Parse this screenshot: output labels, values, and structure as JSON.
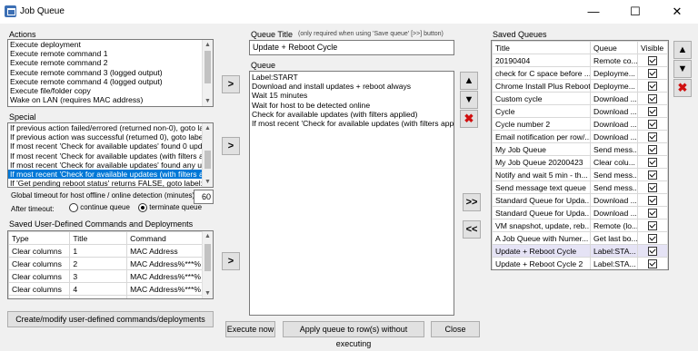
{
  "window": {
    "title": "Job Queue",
    "minimize_icon": "minimize-icon",
    "maximize_icon": "maximize-icon",
    "close_icon": "close-icon"
  },
  "actions": {
    "label": "Actions",
    "items": [
      "Execute deployment",
      "Execute remote command 1",
      "Execute remote command 2",
      "Execute remote command 3 (logged output)",
      "Execute remote command 4 (logged output)",
      "Execute file/folder copy",
      "Wake on LAN (requires MAC address)"
    ]
  },
  "special": {
    "label": "Special",
    "items": [
      "If previous action failed/errored (returned non-0), goto label",
      "If previous action was successful (returned 0), goto label:X",
      "If most recent 'Check for available updates' found 0 update",
      "If most recent 'Check for available updates (with filters appli",
      "If most recent 'Check for available updates' found any upda",
      "If most recent 'Check for available updates (with filters appli",
      "If 'Get pending reboot status' returns FALSE, goto label:X"
    ],
    "selected_index": 5
  },
  "timeout": {
    "label": "Global timeout for host offline / online detection (minutes):",
    "value": "60",
    "after_label": "After timeout:",
    "option_continue": "continue queue",
    "option_terminate": "terminate queue",
    "selected": "terminate"
  },
  "saved_commands": {
    "label": "Saved User-Defined Commands and Deployments",
    "columns": [
      "Type",
      "Title",
      "Command"
    ],
    "rows": [
      [
        "Clear columns",
        "1",
        "MAC Address"
      ],
      [
        "Clear columns",
        "2",
        "MAC Address%***%"
      ],
      [
        "Clear columns",
        "3",
        "MAC Address%***%"
      ],
      [
        "Clear columns",
        "4",
        "MAC Address%***%"
      ],
      [
        "Clear columns",
        "5",
        "MAC Address%***%"
      ]
    ],
    "button": "Create/modify user-defined commands/deployments"
  },
  "queue_title": {
    "label": "Queue Title",
    "hint": "(only required when using 'Save queue' [>>] button)",
    "value": "Update + Reboot Cycle"
  },
  "queue": {
    "label": "Queue",
    "items": [
      "Label:START",
      "Download and install updates + reboot always",
      "Wait 15 minutes",
      "Wait for host to be detected online",
      "Check for available updates (with filters applied)",
      "If most recent 'Check for available updates (with filters applied)"
    ]
  },
  "saved_queues": {
    "label": "Saved Queues",
    "columns": [
      "Title",
      "Queue",
      "Visible"
    ],
    "rows": [
      {
        "title": "20190404",
        "queue": "Remote co...",
        "visible": true
      },
      {
        "title": "check for C space before ...",
        "queue": "Deployme...",
        "visible": true
      },
      {
        "title": "Chrome Install Plus Reboot",
        "queue": "Deployme...",
        "visible": true
      },
      {
        "title": "Custom cycle",
        "queue": "Download ...",
        "visible": true
      },
      {
        "title": "Cycle",
        "queue": "Download ...",
        "visible": true
      },
      {
        "title": "Cycle number 2",
        "queue": "Download ...",
        "visible": true
      },
      {
        "title": "Email notification per row/...",
        "queue": "Download ...",
        "visible": true
      },
      {
        "title": "My Job Queue",
        "queue": "Send mess...",
        "visible": true
      },
      {
        "title": "My Job Queue 20200423",
        "queue": "Clear colu...",
        "visible": true
      },
      {
        "title": "Notify and wait 5 min - th...",
        "queue": "Send mess...",
        "visible": true
      },
      {
        "title": "Send message text queue",
        "queue": "Send mess...",
        "visible": true
      },
      {
        "title": "Standard Queue for Upda...",
        "queue": "Download ...",
        "visible": true
      },
      {
        "title": "Standard Queue for Upda...",
        "queue": "Download ...",
        "visible": true
      },
      {
        "title": "VM snapshot, update, reb...",
        "queue": "Remote (lo...",
        "visible": true
      },
      {
        "title": "A Job Queue with Numer...",
        "queue": "Get last bo...",
        "visible": true
      },
      {
        "title": "Update + Reboot Cycle",
        "queue": "Label:STA...",
        "visible": true
      },
      {
        "title": "Update + Reboot Cycle 2",
        "queue": "Label:STA...",
        "visible": true
      }
    ],
    "selected_index": 15
  },
  "buttons": {
    "add_arrow": ">",
    "up_arrow": "up-arrow-icon",
    "down_arrow": "down-arrow-icon",
    "delete": "delete-x-icon",
    "save_queue": ">>",
    "load_queue": "<<",
    "execute_now": "Execute now",
    "apply_queue": "Apply queue to row(s) without executing",
    "close": "Close"
  },
  "colors": {
    "selection": "#0078d7",
    "delete_red": "#d01010"
  }
}
